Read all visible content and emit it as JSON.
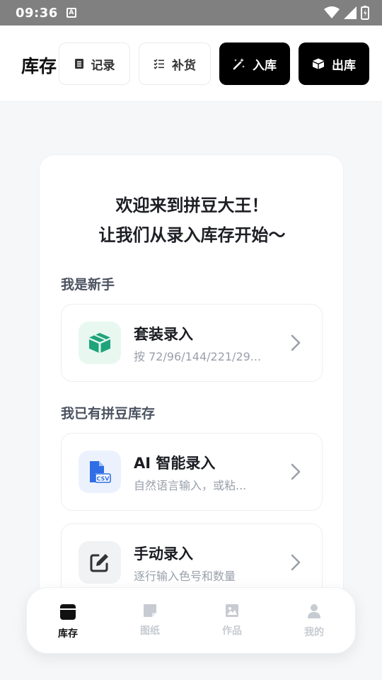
{
  "status_bar": {
    "time": "09:36",
    "notif_letter": "A"
  },
  "header": {
    "title": "库存",
    "buttons": [
      {
        "label": "记录",
        "icon": "document-list-icon",
        "style": "light"
      },
      {
        "label": "补货",
        "icon": "checklist-icon",
        "style": "light"
      },
      {
        "label": "入库",
        "icon": "magic-wand-icon",
        "style": "dark"
      },
      {
        "label": "出库",
        "icon": "box-out-icon",
        "style": "dark"
      }
    ]
  },
  "welcome": {
    "line1": "欢迎来到拼豆大王！",
    "line2": "让我们从录入库存开始～"
  },
  "sections": {
    "beginner": "我是新手",
    "existing": "我已有拼豆库存"
  },
  "options": [
    {
      "title": "套装录入",
      "subtitle": "按 72/96/144/221/29...",
      "icon": "box-icon",
      "icon_bg": "#e8f8f1",
      "icon_color": "#1fa37a"
    },
    {
      "title": "AI 智能录入",
      "subtitle": "自然语言输入，或粘...",
      "icon": "csv-file-icon",
      "icon_bg": "#ecf2fd",
      "icon_color": "#2f6ee5"
    },
    {
      "title": "手动录入",
      "subtitle": "逐行输入色号和数量",
      "icon": "edit-icon",
      "icon_bg": "#f1f2f4",
      "icon_color": "#333333"
    }
  ],
  "bottom_nav": [
    {
      "label": "库存",
      "icon": "inventory-box-icon",
      "active": true
    },
    {
      "label": "图纸",
      "icon": "note-icon",
      "active": false
    },
    {
      "label": "作品",
      "icon": "image-icon",
      "active": false
    },
    {
      "label": "我的",
      "icon": "user-icon",
      "active": false
    }
  ]
}
